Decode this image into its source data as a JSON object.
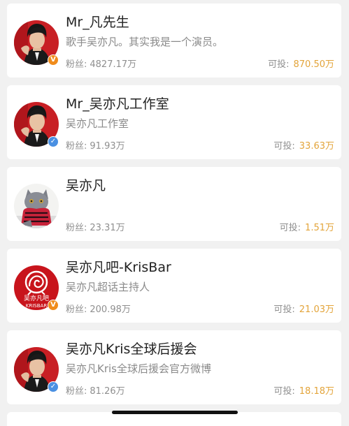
{
  "labels": {
    "fans": "粉丝:",
    "invest": "可投:"
  },
  "accounts": [
    {
      "name": "Mr_凡先生",
      "desc": "歌手吴亦凡。其实我是一个演员。",
      "fans": "4827.17万",
      "invest": "870.50万",
      "badge": "orange",
      "avatar": "portrait-red-icon"
    },
    {
      "name": "Mr_吴亦凡工作室",
      "desc": "吴亦凡工作室",
      "fans": "91.93万",
      "invest": "33.63万",
      "badge": "blue",
      "avatar": "portrait-red-icon"
    },
    {
      "name": "吴亦凡",
      "desc": "",
      "fans": "23.31万",
      "invest": "1.51万",
      "badge": "none",
      "avatar": "cat-photo-icon"
    },
    {
      "name": "吴亦凡吧-KrisBar",
      "desc": "吴亦凡超话主持人",
      "fans": "200.98万",
      "invest": "21.03万",
      "badge": "orange",
      "avatar": "dragon-logo-icon",
      "logo_text": "吴亦凡吧",
      "logo_sub": "KRISBAR"
    },
    {
      "name": "吴亦凡Kris全球后援会",
      "desc": "吴亦凡Kris全球后援会官方微博",
      "fans": "81.26万",
      "invest": "18.18万",
      "badge": "blue",
      "avatar": "portrait-red-icon"
    }
  ],
  "colors": {
    "background": "#f1f1f1",
    "card": "#ffffff",
    "name": "#222222",
    "secondary": "#8a8a8a",
    "invest_value": "#e3a43a",
    "badge_orange": "#f08c1c",
    "badge_blue": "#4a90e2"
  }
}
